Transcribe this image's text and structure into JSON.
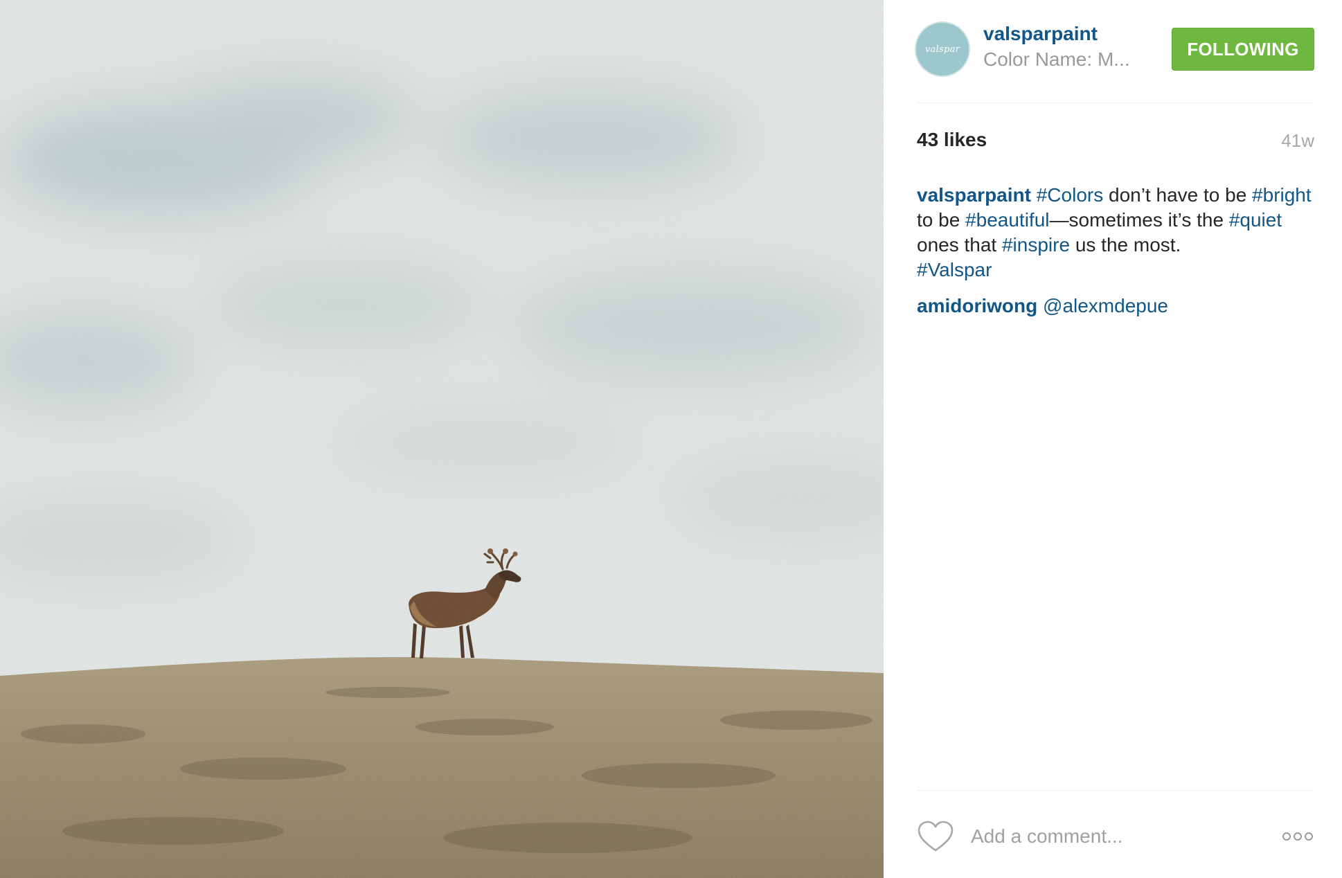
{
  "photo": {
    "alt_subject": "caribou",
    "colors": {
      "sky": "#e4e8e7",
      "cloud": "#9fb5b6",
      "grass": "#9a8a6c",
      "animal": "#5a3c26"
    }
  },
  "header": {
    "avatar_text": "valspar",
    "username": "valsparpaint",
    "subtitle": "Color Name: M...",
    "follow_label": "FOLLOWING"
  },
  "stats": {
    "likes": "43 likes",
    "age": "41w"
  },
  "caption": {
    "username": "valsparpaint",
    "tag_colors": "#Colors",
    "t1": " don’t have to be ",
    "tag_bright": "#bright",
    "t2": " to be ",
    "tag_beautiful": "#beautiful",
    "t3": "—sometimes it’s the ",
    "tag_quiet": "#quiet",
    "t4": " ones that ",
    "tag_inspire": "#inspire",
    "t5": " us the most. ",
    "tag_valspar": "#Valspar"
  },
  "comments": [
    {
      "username": "amidoriwong",
      "text": "@alexmdepue"
    }
  ],
  "footer": {
    "comment_placeholder": "Add a comment...",
    "like_icon": "heart-icon",
    "more_icon": "more-options-icon"
  },
  "theme": {
    "link": "#125688",
    "follow_green": "#6fb83f",
    "muted": "#999999"
  }
}
